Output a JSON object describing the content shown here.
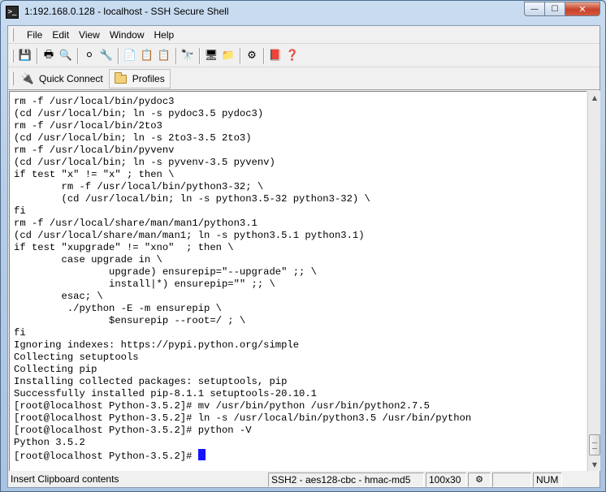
{
  "window": {
    "title": "1:192.168.0.128 - localhost - SSH Secure Shell",
    "app_icon_glyph": ">_"
  },
  "window_buttons": {
    "minimize": "—",
    "maximize": "☐",
    "close": "✕"
  },
  "menu": [
    "File",
    "Edit",
    "View",
    "Window",
    "Help"
  ],
  "toolbar": [
    {
      "name": "save-icon",
      "glyph": "💾"
    },
    {
      "sep": true
    },
    {
      "name": "print-icon",
      "glyph": "🖶"
    },
    {
      "name": "print-preview-icon",
      "glyph": "🔍"
    },
    {
      "sep": true
    },
    {
      "name": "disconnect-icon",
      "glyph": "⚪"
    },
    {
      "name": "reconnect-icon",
      "glyph": "🔧"
    },
    {
      "sep": true
    },
    {
      "name": "copy-icon",
      "glyph": "📄"
    },
    {
      "name": "paste-icon",
      "glyph": "📋"
    },
    {
      "name": "paste-disabled-icon",
      "glyph": "📋"
    },
    {
      "sep": true
    },
    {
      "name": "find-icon",
      "glyph": "🔭"
    },
    {
      "sep": true
    },
    {
      "name": "new-terminal-icon",
      "glyph": "🖥"
    },
    {
      "name": "new-file-transfer-icon",
      "glyph": "📁"
    },
    {
      "sep": true
    },
    {
      "name": "settings-icon",
      "glyph": "⚙"
    },
    {
      "sep": true
    },
    {
      "name": "help-book-icon",
      "glyph": "📕"
    },
    {
      "name": "context-help-icon",
      "glyph": "❓"
    }
  ],
  "profilebar": {
    "quick_connect": "Quick Connect",
    "profiles": "Profiles"
  },
  "terminal": {
    "lines": [
      "rm -f /usr/local/bin/pydoc3",
      "(cd /usr/local/bin; ln -s pydoc3.5 pydoc3)",
      "rm -f /usr/local/bin/2to3",
      "(cd /usr/local/bin; ln -s 2to3-3.5 2to3)",
      "rm -f /usr/local/bin/pyvenv",
      "(cd /usr/local/bin; ln -s pyvenv-3.5 pyvenv)",
      "if test \"x\" != \"x\" ; then \\",
      "        rm -f /usr/local/bin/python3-32; \\",
      "        (cd /usr/local/bin; ln -s python3.5-32 python3-32) \\",
      "fi",
      "rm -f /usr/local/share/man/man1/python3.1",
      "(cd /usr/local/share/man/man1; ln -s python3.5.1 python3.1)",
      "if test \"xupgrade\" != \"xno\"  ; then \\",
      "        case upgrade in \\",
      "                upgrade) ensurepip=\"--upgrade\" ;; \\",
      "                install|*) ensurepip=\"\" ;; \\",
      "        esac; \\",
      "         ./python -E -m ensurepip \\",
      "                $ensurepip --root=/ ; \\",
      "fi",
      "Ignoring indexes: https://pypi.python.org/simple",
      "Collecting setuptools",
      "Collecting pip",
      "Installing collected packages: setuptools, pip",
      "Successfully installed pip-8.1.1 setuptools-20.10.1",
      "[root@localhost Python-3.5.2]# mv /usr/bin/python /usr/bin/python2.7.5",
      "[root@localhost Python-3.5.2]# ln -s /usr/local/bin/python3.5 /usr/bin/python",
      "[root@localhost Python-3.5.2]# python -V",
      "Python 3.5.2"
    ],
    "prompt": "[root@localhost Python-3.5.2]# ",
    "cursor_color": "#1414ff"
  },
  "statusbar": {
    "message": "Insert Clipboard contents",
    "cipher": "SSH2 - aes128-cbc - hmac-md5",
    "size": "100x30",
    "icon_glyph": "⚙",
    "num": "NUM"
  }
}
